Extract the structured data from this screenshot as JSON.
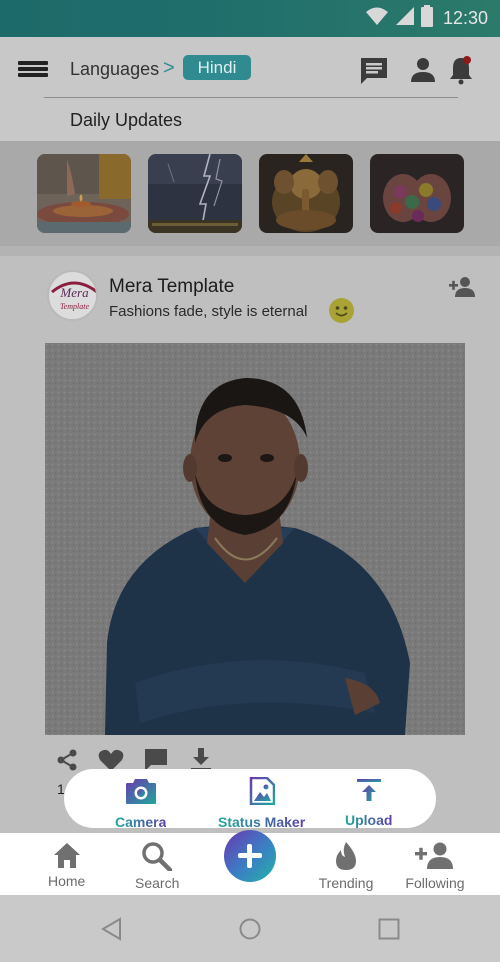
{
  "status_bar": {
    "time": "12:30",
    "icons": [
      "wifi-icon",
      "signal-icon",
      "battery-icon"
    ]
  },
  "header": {
    "breadcrumb_root": "Languages",
    "breadcrumb_separator": ">",
    "selected_language": "Hindi",
    "section_title": "Daily Updates",
    "icons": [
      "menu-icon",
      "chat-icon",
      "profile-icon",
      "notification-icon"
    ]
  },
  "thumbnails": [
    {
      "name": "diya-thumbnail"
    },
    {
      "name": "lightning-thumbnail"
    },
    {
      "name": "ganesha-thumbnail"
    },
    {
      "name": "holi-colors-thumbnail"
    }
  ],
  "post": {
    "account_name": "Mera Template",
    "caption": "Fashions fade, style is eternal",
    "avatar_text_1": "Mera",
    "avatar_text_2": "Template",
    "like_count": "1"
  },
  "popup": {
    "camera_label": "Camera",
    "status_maker_label": "Status Maker",
    "upload_label": "Upload"
  },
  "bottom_nav": {
    "home": "Home",
    "search": "Search",
    "trending": "Trending",
    "following": "Following"
  },
  "colors": {
    "accent": "#2f8b8f",
    "gradient_start": "#1fa79c",
    "gradient_end": "#5b3ea8",
    "overlay": "#bfbfbf"
  }
}
